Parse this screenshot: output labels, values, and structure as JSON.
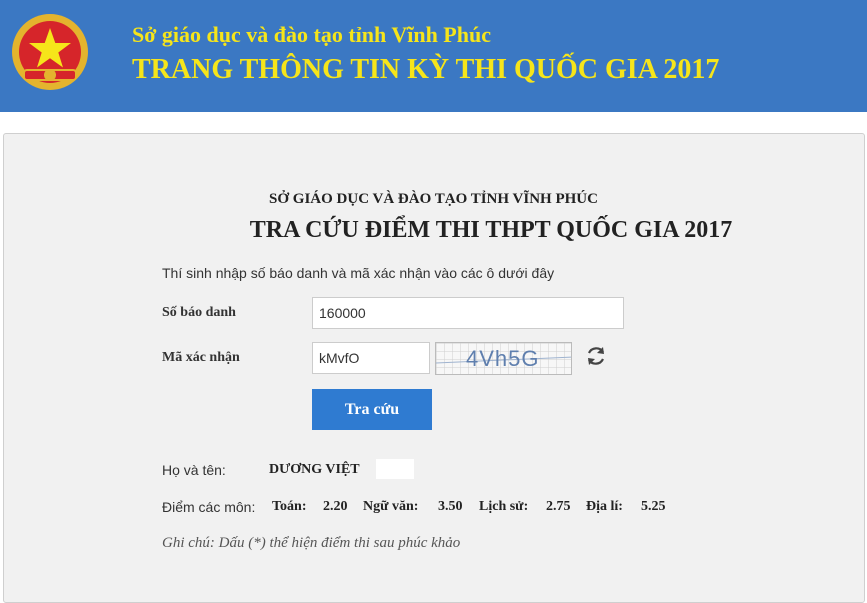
{
  "header": {
    "subtitle": "Sở giáo dục và đào tạo tỉnh Vĩnh Phúc",
    "title": "TRANG THÔNG TIN KỲ THI QUỐC GIA 2017",
    "background_color": "#3b78c3",
    "text_color": "#f6e51a",
    "emblem_icon": "national-emblem-icon"
  },
  "panel": {
    "org_name": "SỞ GIÁO DỤC VÀ ĐÀO TẠO TỈNH VĨNH PHÚC",
    "title": "TRA CỨU ĐIỂM THI THPT QUỐC GIA 2017",
    "instruction": "Thí sinh nhập số báo danh và mã xác nhận vào các ô dưới đây"
  },
  "form": {
    "sbd_label": "Số báo danh",
    "sbd_value": "160000",
    "captcha_label": "Mã xác nhận",
    "captcha_value": "kMvfO",
    "captcha_image_text": "4Vh5G",
    "refresh_icon": "refresh-icon",
    "submit_label": "Tra cứu",
    "button_color": "#2f7bd1"
  },
  "result": {
    "name_label": "Họ và tên:",
    "name_value": "DƯƠNG VIỆT",
    "scores_label": "Điểm các môn:",
    "scores": [
      {
        "subject": "Toán:",
        "score": "2.20"
      },
      {
        "subject": "Ngữ văn:",
        "score": "3.50"
      },
      {
        "subject": "Lịch sử:",
        "score": "2.75"
      },
      {
        "subject": "Địa lí:",
        "score": "5.25"
      }
    ],
    "note": "Ghi chú: Dấu (*) thể hiện điểm thi sau phúc khảo"
  }
}
